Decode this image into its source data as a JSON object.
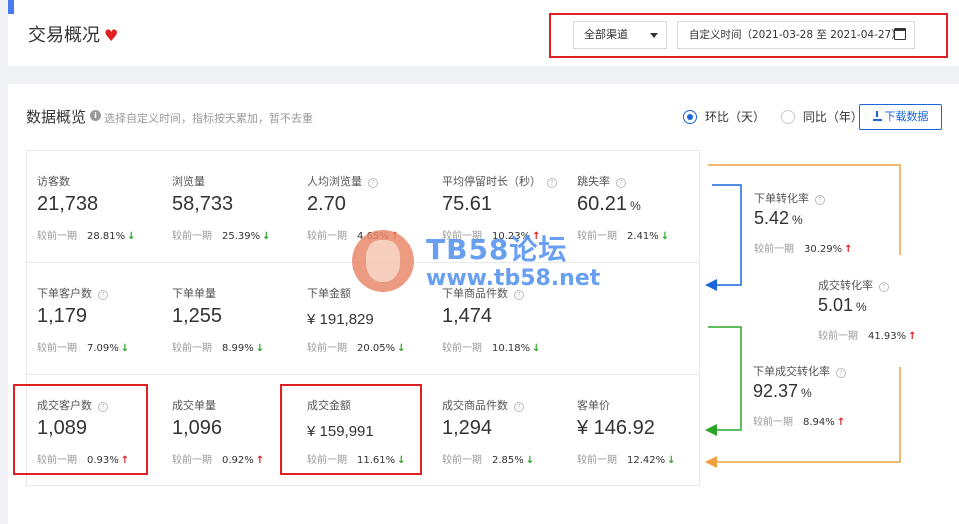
{
  "header": {
    "title": "交易概况",
    "channel_select": "全部渠道",
    "date_range": "自定义时间（2021-03-28 至 2021-04-27）"
  },
  "overview": {
    "title": "数据概览",
    "hint": "选择自定义时间，指标按天累加，暂不去重",
    "radio_day": "环比（天）",
    "radio_year": "同比（年）",
    "download_label": "下载数据"
  },
  "compare_label": "较前一期",
  "metrics": {
    "row1": [
      {
        "label": "访客数",
        "value": "21,738",
        "pct": "28.81%",
        "dir": "down"
      },
      {
        "label": "浏览量",
        "value": "58,733",
        "pct": "25.39%",
        "dir": "down"
      },
      {
        "label": "人均浏览量",
        "value": "2.70",
        "pct": "4.65%",
        "dir": "up"
      },
      {
        "label": "平均停留时长（秒）",
        "value": "75.61",
        "pct": "10.23%",
        "dir": "up"
      },
      {
        "label": "跳失率",
        "value": "60.21",
        "unit": "%",
        "pct": "2.41%",
        "dir": "down"
      }
    ],
    "row2": [
      {
        "label": "下单客户数",
        "value": "1,179",
        "pct": "7.09%",
        "dir": "down"
      },
      {
        "label": "下单单量",
        "value": "1,255",
        "pct": "8.99%",
        "dir": "down"
      },
      {
        "label": "下单金额",
        "value": "¥ 191,829",
        "pct": "20.05%",
        "dir": "down"
      },
      {
        "label": "下单商品件数",
        "value": "1,474",
        "pct": "10.18%",
        "dir": "down"
      }
    ],
    "row3": [
      {
        "label": "成交客户数",
        "value": "1,089",
        "pct": "0.93%",
        "dir": "up"
      },
      {
        "label": "成交单量",
        "value": "1,096",
        "pct": "0.92%",
        "dir": "up"
      },
      {
        "label": "成交金额",
        "value": "¥ 159,991",
        "pct": "11.61%",
        "dir": "down"
      },
      {
        "label": "成交商品件数",
        "value": "1,294",
        "pct": "2.85%",
        "dir": "down"
      },
      {
        "label": "客单价",
        "value": "¥ 146.92",
        "pct": "12.42%",
        "dir": "down"
      }
    ]
  },
  "side": {
    "order_conv": {
      "label": "下单转化率",
      "value": "5.42",
      "unit": "%",
      "pct": "30.29%",
      "dir": "up"
    },
    "deal_conv": {
      "label": "成交转化率",
      "value": "5.01",
      "unit": "%",
      "pct": "41.93%",
      "dir": "up"
    },
    "order_deal_conv": {
      "label": "下单成交转化率",
      "value": "92.37",
      "unit": "%",
      "pct": "8.94%",
      "dir": "up"
    }
  },
  "watermark": {
    "title": "TB58论坛",
    "url": "www.tb58.net"
  },
  "colors": {
    "accent": "#1a66d9",
    "up": "#e02020",
    "down": "#2aa52a",
    "flow_orange": "#f0a040",
    "flow_green": "#2aa52a",
    "flow_blue": "#1a66d9",
    "highlight": "#e02020"
  }
}
